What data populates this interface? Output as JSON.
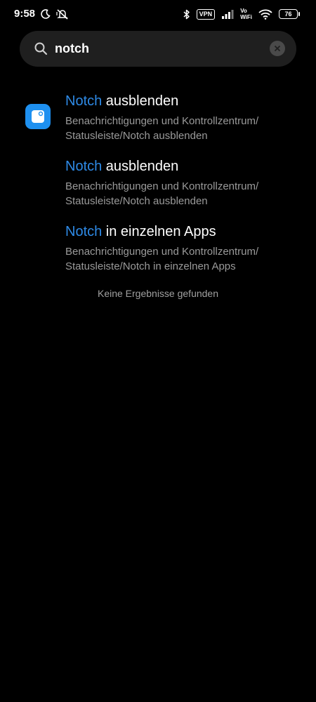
{
  "status_bar": {
    "time": "9:58",
    "vpn_label": "VPN",
    "vowifi_top": "Vo",
    "vowifi_bottom": "WiFi",
    "battery_level": "76",
    "icons": [
      "moon-icon",
      "mute-vibrate-icon",
      "bluetooth-icon",
      "signal-icon",
      "wifi-icon",
      "battery-icon"
    ]
  },
  "search": {
    "value": "notch",
    "placeholder": "",
    "icons": [
      "search-icon",
      "clear-icon"
    ]
  },
  "results": [
    {
      "title_highlight": "Notch",
      "title_rest": " ausblenden",
      "path_line1": "Benachrichtigungen und Kontrollzentrum/",
      "path_line2": "Statusleiste/Notch ausblenden",
      "has_icon": true
    },
    {
      "title_highlight": "Notch",
      "title_rest": " ausblenden",
      "path_line1": "Benachrichtigungen und Kontrollzentrum/",
      "path_line2": "Statusleiste/Notch ausblenden",
      "has_icon": false
    },
    {
      "title_highlight": "Notch",
      "title_rest": " in einzelnen Apps",
      "path_line1": "Benachrichtigungen und Kontrollzentrum/",
      "path_line2": "Statusleiste/Notch in einzelnen Apps",
      "has_icon": false
    }
  ],
  "no_results_text": "Keine Ergebnisse gefunden",
  "colors": {
    "background": "#000000",
    "search_bg": "#1f1f1f",
    "highlight": "#2e8ae6",
    "app_icon": "#1e90f0",
    "secondary_text": "#9a9a9a"
  }
}
